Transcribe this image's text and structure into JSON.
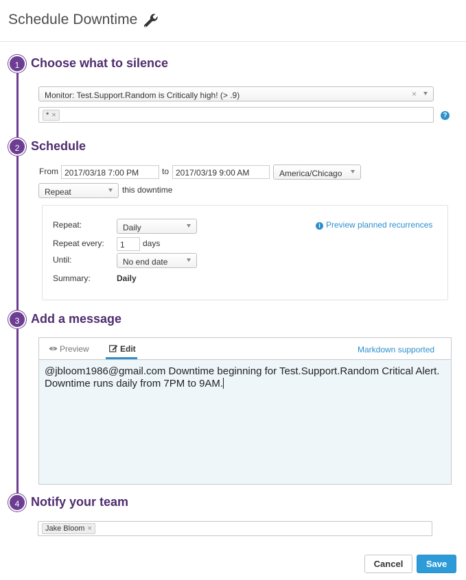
{
  "header": {
    "title": "Schedule Downtime",
    "icon": "wrench-icon"
  },
  "steps": [
    {
      "number": "1",
      "title": "Choose what to silence"
    },
    {
      "number": "2",
      "title": "Schedule"
    },
    {
      "number": "3",
      "title": "Add a message"
    },
    {
      "number": "4",
      "title": "Notify your team"
    }
  ],
  "silence": {
    "monitor_value": "Monitor: Test.Support.Random is Critically high! (> .9)",
    "clear_glyph": "×",
    "scope_tag": "*",
    "tag_remove_glyph": "×",
    "help_glyph": "?"
  },
  "schedule": {
    "from_label": "From",
    "from_value": "2017/03/18 7:00 PM",
    "to_label": "to",
    "to_value": "2017/03/19 9:00 AM",
    "timezone": "America/Chicago",
    "mode": "Repeat",
    "mode_suffix": "this downtime",
    "repeat_label": "Repeat:",
    "repeat_value": "Daily",
    "repeat_every_label": "Repeat every:",
    "repeat_every_value": "1",
    "repeat_every_unit": "days",
    "until_label": "Until:",
    "until_value": "No end date",
    "summary_label": "Summary:",
    "summary_value": "Daily",
    "preview_link": "Preview planned recurrences",
    "info_glyph": "i"
  },
  "message": {
    "tab_preview": "Preview",
    "tab_edit": "Edit",
    "markdown_link": "Markdown supported",
    "text": "@jbloom1986@gmail.com Downtime beginning for Test.Support.Random Critical Alert. Downtime runs daily from 7PM to 9AM."
  },
  "notify": {
    "recipient": "Jake Bloom",
    "remove_glyph": "×"
  },
  "actions": {
    "cancel": "Cancel",
    "save": "Save"
  },
  "colors": {
    "accent_purple": "#6c3d91",
    "link_blue": "#2d8fcb",
    "save_blue": "#2d9bd8",
    "editor_bg": "#eef6fa"
  }
}
